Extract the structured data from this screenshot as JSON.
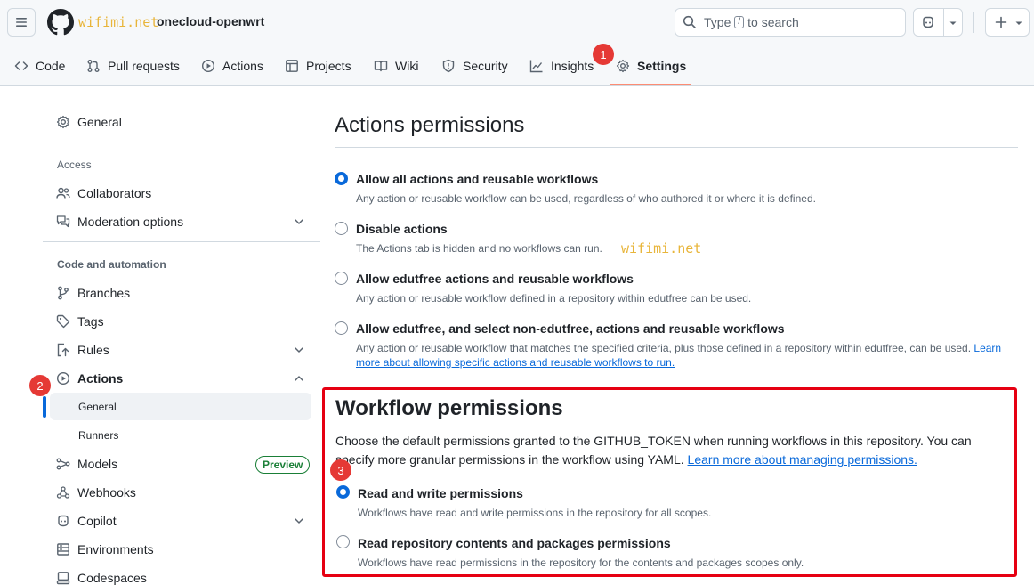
{
  "header": {
    "watermark": "wifimi.net",
    "repo_name": "onecloud-openwrt",
    "search": {
      "prefix": "Type",
      "key": "/",
      "suffix": "to search"
    }
  },
  "tabs": [
    {
      "label": "Code",
      "icon": "code-icon"
    },
    {
      "label": "Pull requests",
      "icon": "pull-request-icon"
    },
    {
      "label": "Actions",
      "icon": "play-icon"
    },
    {
      "label": "Projects",
      "icon": "table-icon"
    },
    {
      "label": "Wiki",
      "icon": "book-icon"
    },
    {
      "label": "Security",
      "icon": "shield-icon"
    },
    {
      "label": "Insights",
      "icon": "graph-icon"
    },
    {
      "label": "Settings",
      "icon": "gear-icon",
      "selected": true
    }
  ],
  "badges": {
    "one": "1",
    "two": "2",
    "three": "3"
  },
  "sidebar": {
    "general": "General",
    "access_heading": "Access",
    "collaborators": "Collaborators",
    "moderation": "Moderation options",
    "code_heading": "Code and automation",
    "branches": "Branches",
    "tags": "Tags",
    "rules": "Rules",
    "actions": "Actions",
    "actions_general": "General",
    "runners": "Runners",
    "models": "Models",
    "preview": "Preview",
    "webhooks": "Webhooks",
    "copilot": "Copilot",
    "environments": "Environments",
    "codespaces": "Codespaces"
  },
  "actions_permissions": {
    "title": "Actions permissions",
    "options": [
      {
        "label": "Allow all actions and reusable workflows",
        "desc": "Any action or reusable workflow can be used, regardless of who authored it or where it is defined.",
        "checked": true
      },
      {
        "label": "Disable actions",
        "desc": "The Actions tab is hidden and no workflows can run.",
        "checked": false
      },
      {
        "label": "Allow edutfree actions and reusable workflows",
        "desc": "Any action or reusable workflow defined in a repository within edutfree can be used.",
        "checked": false
      },
      {
        "label": "Allow edutfree, and select non-edutfree, actions and reusable workflows",
        "desc": "Any action or reusable workflow that matches the specified criteria, plus those defined in a repository within edutfree, can be used.",
        "link_a": "Learn",
        "link_b": "more about allowing specific actions and reusable workflows to run.",
        "checked": false
      }
    ],
    "watermark": "wifimi.net"
  },
  "workflow_permissions": {
    "title": "Workflow permissions",
    "desc": "Choose the default permissions granted to the GITHUB_TOKEN when running workflows in this repository. You can specify more granular permissions in the workflow using YAML.",
    "link": "Learn more about managing permissions.",
    "options": [
      {
        "label": "Read and write permissions",
        "desc": "Workflows have read and write permissions in the repository for all scopes.",
        "checked": true
      },
      {
        "label": "Read repository contents and packages permissions",
        "desc": "Workflows have read permissions in the repository for the contents and packages scopes only.",
        "checked": false
      }
    ]
  },
  "colors": {
    "accent": "#0969da",
    "highlight": "#e60012",
    "badge": "#e53935",
    "tab_underline": "#fd8c73"
  }
}
